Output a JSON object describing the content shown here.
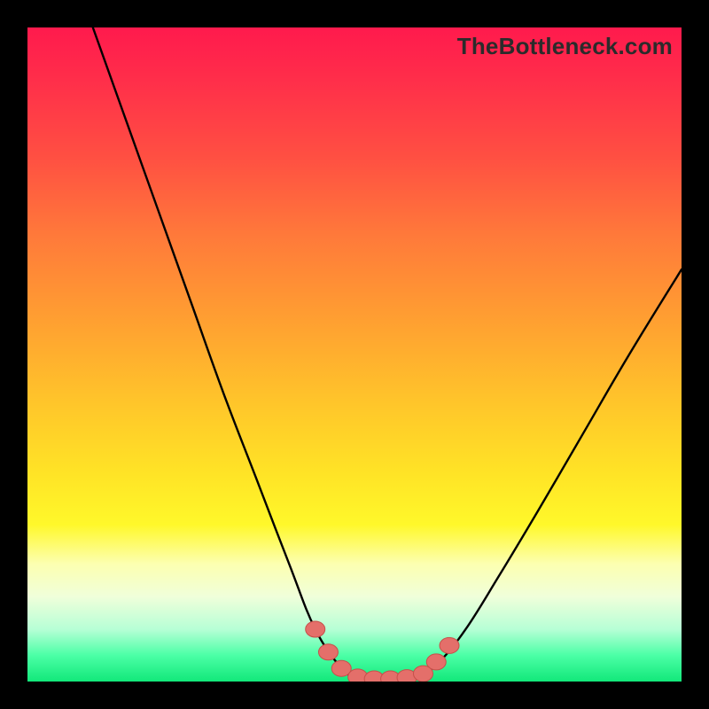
{
  "watermark": "TheBottleneck.com",
  "colors": {
    "frame": "#000000",
    "curve_stroke": "#000000",
    "marker_fill": "#E46F6A",
    "marker_stroke": "#C74F4A",
    "gradient_top": "#ff1a4d",
    "gradient_bottom": "#12e87a"
  },
  "chart_data": {
    "type": "line",
    "title": "",
    "xlabel": "",
    "ylabel": "",
    "xlim": [
      0,
      100
    ],
    "ylim": [
      0,
      100
    ],
    "grid": false,
    "legend": false,
    "annotations": [],
    "series": [
      {
        "name": "left-branch",
        "x": [
          10,
          15,
          20,
          25,
          30,
          35,
          40,
          44,
          48,
          49.5
        ],
        "values": [
          100,
          86,
          72,
          58,
          44,
          31,
          18,
          8,
          2,
          1
        ]
      },
      {
        "name": "floor",
        "x": [
          49.5,
          51,
          53,
          55,
          57,
          59,
          60.5
        ],
        "values": [
          1,
          0.6,
          0.4,
          0.4,
          0.4,
          0.6,
          1
        ]
      },
      {
        "name": "right-branch",
        "x": [
          60.5,
          63,
          67,
          72,
          78,
          85,
          92,
          100
        ],
        "values": [
          1,
          3,
          8,
          16,
          26,
          38,
          50,
          63
        ]
      }
    ],
    "markers": [
      {
        "x": 44.0,
        "y": 8.0
      },
      {
        "x": 46.0,
        "y": 4.5
      },
      {
        "x": 48.0,
        "y": 2.0
      },
      {
        "x": 50.5,
        "y": 0.7
      },
      {
        "x": 53.0,
        "y": 0.4
      },
      {
        "x": 55.5,
        "y": 0.4
      },
      {
        "x": 58.0,
        "y": 0.6
      },
      {
        "x": 60.5,
        "y": 1.2
      },
      {
        "x": 62.5,
        "y": 3.0
      },
      {
        "x": 64.5,
        "y": 5.5
      }
    ]
  }
}
